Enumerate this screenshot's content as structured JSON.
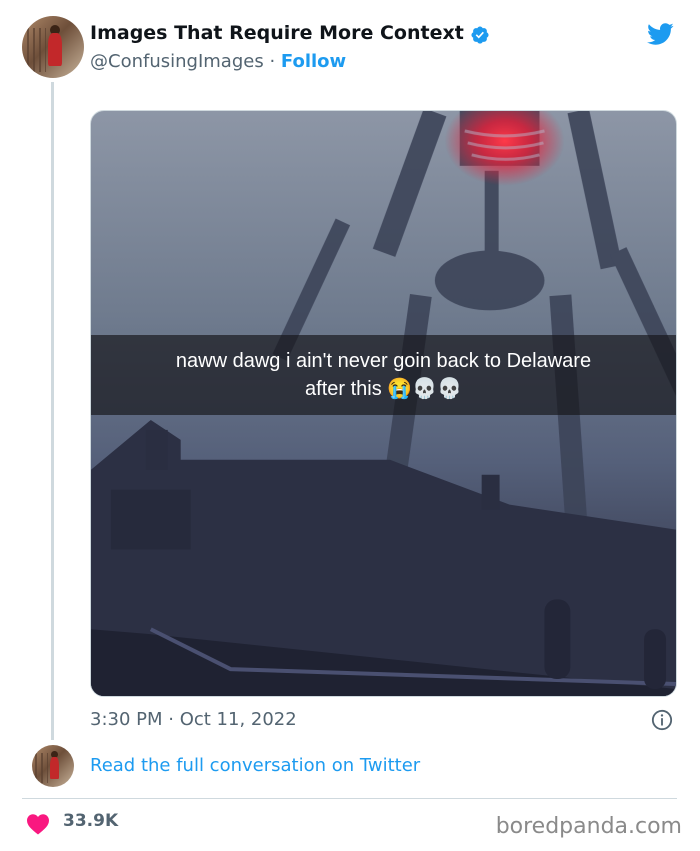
{
  "tweet": {
    "display_name": "Images That Require More Context",
    "handle": "@ConfusingImages",
    "separator": "·",
    "follow_label": "Follow",
    "timestamp": "3:30 PM · Oct 11, 2022",
    "read_full_label": "Read the full conversation on Twitter",
    "likes": "33.9K"
  },
  "media": {
    "caption_line1": "naww dawg i ain't never goin back to Delaware",
    "caption_line2": "after this 😭💀💀"
  },
  "footer": {
    "watermark": "boredpanda.com"
  },
  "colors": {
    "accent": "#1d9bf0",
    "heart": "#f91880",
    "muted_text": "#536471"
  },
  "icons": [
    "verified-badge-icon",
    "twitter-bird-icon",
    "info-icon",
    "heart-icon"
  ]
}
